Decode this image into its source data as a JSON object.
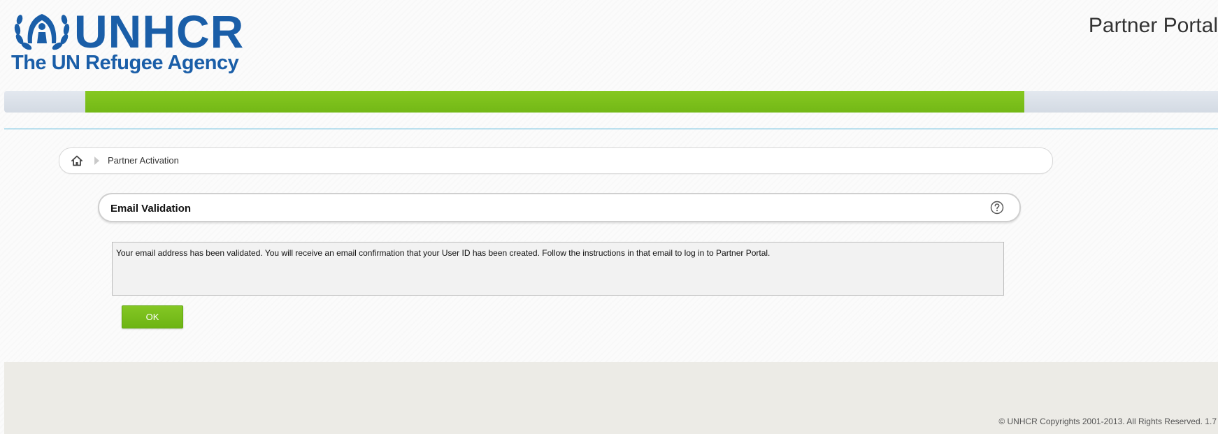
{
  "header": {
    "logo_word": "UNHCR",
    "logo_tagline": "The UN Refugee Agency",
    "portal_title": "Partner Portal"
  },
  "breadcrumb": {
    "items": [
      "Partner Activation"
    ]
  },
  "panel": {
    "title": "Email Validation",
    "help_icon": "question-circle-icon"
  },
  "message": {
    "text": "Your email address has been validated. You will receive an email confirmation that your User ID has been created. Follow the instructions in that email to log in to Partner Portal."
  },
  "actions": {
    "ok_label": "OK"
  },
  "footer": {
    "copyright": "© UNHCR Copyrights 2001-2013. All Rights Reserved.  1.7"
  },
  "colors": {
    "brand_blue": "#1a5ea8",
    "accent_green": "#7dc21e",
    "rule_blue": "#4fb3d9"
  }
}
